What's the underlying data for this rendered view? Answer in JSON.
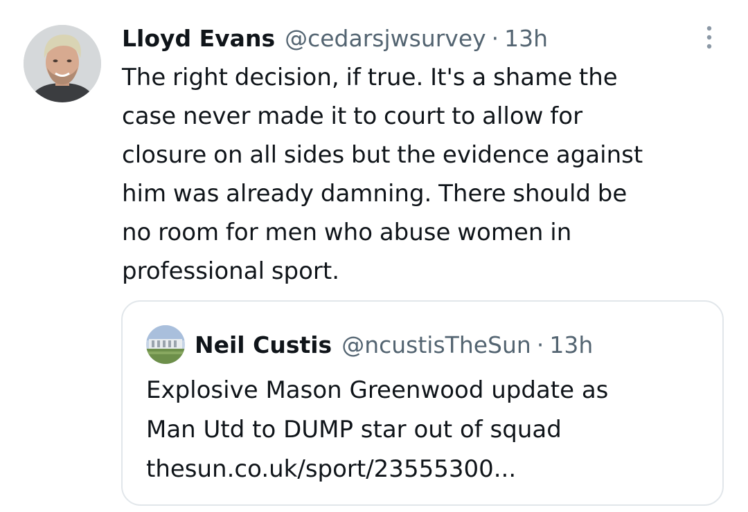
{
  "tweet": {
    "author": {
      "display_name": "Lloyd Evans",
      "handle": "@cedarsjwsurvey",
      "avatar_icon": "user-avatar"
    },
    "separator": "·",
    "timestamp": "13h",
    "more_icon": "vertical-dots-icon",
    "text_lines": [
      "The right decision, if true. It's a shame the",
      "case never made it to court to allow for",
      "closure on all sides but the evidence against",
      "him was already damning. There should be",
      "no room for men who abuse women in",
      "professional sport."
    ]
  },
  "quoted_tweet": {
    "author": {
      "display_name": "Neil Custis",
      "handle": "@ncustisTheSun",
      "avatar_icon": "stadium-avatar"
    },
    "separator": "·",
    "timestamp": "13h",
    "text_lines": [
      "Explosive Mason Greenwood update as",
      "Man Utd to DUMP star out of squad",
      "thesun.co.uk/sport/23555300..."
    ]
  },
  "colors": {
    "text_primary": "#0f1419",
    "text_secondary": "#536471",
    "border": "#e1e6ea",
    "background": "#ffffff"
  }
}
